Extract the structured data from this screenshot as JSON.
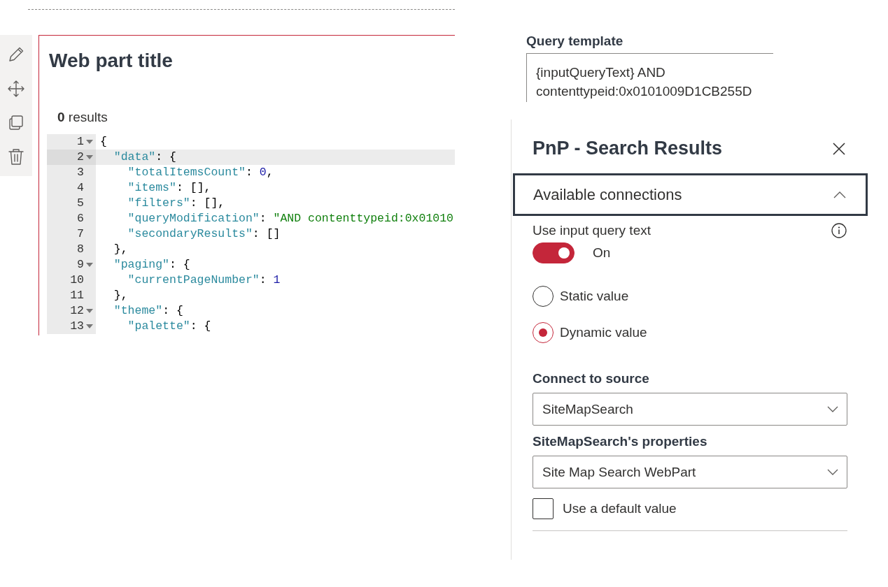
{
  "web_part": {
    "title": "Web part title",
    "results": "**0** results",
    "code_lines": [
      {
        "number": "1",
        "foldable": true,
        "selected": false,
        "tokens": [
          {
            "kind": "punct",
            "text": "{"
          }
        ]
      },
      {
        "number": "2",
        "foldable": true,
        "selected": true,
        "tokens": [
          {
            "kind": "key",
            "text": "  \"data\""
          },
          {
            "kind": "punct",
            "text": ": {"
          }
        ]
      },
      {
        "number": "3",
        "foldable": false,
        "selected": false,
        "tokens": [
          {
            "kind": "key",
            "text": "    \"totalItemsCount\""
          },
          {
            "kind": "punct",
            "text": ": "
          },
          {
            "kind": "number",
            "text": "0"
          },
          {
            "kind": "punct",
            "text": ","
          }
        ]
      },
      {
        "number": "4",
        "foldable": false,
        "selected": false,
        "tokens": [
          {
            "kind": "key",
            "text": "    \"items\""
          },
          {
            "kind": "punct",
            "text": ": [],"
          }
        ]
      },
      {
        "number": "5",
        "foldable": false,
        "selected": false,
        "tokens": [
          {
            "kind": "key",
            "text": "    \"filters\""
          },
          {
            "kind": "punct",
            "text": ": [],"
          }
        ]
      },
      {
        "number": "6",
        "foldable": false,
        "selected": false,
        "tokens": [
          {
            "kind": "key",
            "text": "    \"queryModification\""
          },
          {
            "kind": "punct",
            "text": ": "
          },
          {
            "kind": "string",
            "text": "\"AND contenttypeid:0x01010"
          }
        ]
      },
      {
        "number": "7",
        "foldable": false,
        "selected": false,
        "tokens": [
          {
            "kind": "key",
            "text": "    \"secondaryResults\""
          },
          {
            "kind": "punct",
            "text": ": []"
          }
        ]
      },
      {
        "number": "8",
        "foldable": false,
        "selected": false,
        "tokens": [
          {
            "kind": "punct",
            "text": "  },"
          }
        ]
      },
      {
        "number": "9",
        "foldable": true,
        "selected": false,
        "tokens": [
          {
            "kind": "key",
            "text": "  \"paging\""
          },
          {
            "kind": "punct",
            "text": ": {"
          }
        ]
      },
      {
        "number": "10",
        "foldable": false,
        "selected": false,
        "tokens": [
          {
            "kind": "key",
            "text": "    \"currentPageNumber\""
          },
          {
            "kind": "punct",
            "text": ": "
          },
          {
            "kind": "number",
            "text": "1"
          }
        ]
      },
      {
        "number": "11",
        "foldable": false,
        "selected": false,
        "tokens": [
          {
            "kind": "punct",
            "text": "  },"
          }
        ]
      },
      {
        "number": "12",
        "foldable": true,
        "selected": false,
        "tokens": [
          {
            "kind": "key",
            "text": "  \"theme\""
          },
          {
            "kind": "punct",
            "text": ": {"
          }
        ]
      },
      {
        "number": "13",
        "foldable": true,
        "selected": false,
        "tokens": [
          {
            "kind": "key",
            "text": "    \"palette\""
          },
          {
            "kind": "punct",
            "text": ": {"
          }
        ]
      }
    ]
  },
  "query_template": {
    "label": "Query template",
    "lines": [
      "{inputQueryText} AND",
      "contenttypeid:0x0101009D1CB255D"
    ]
  },
  "panel": {
    "title": "PnP - Search Results",
    "section": {
      "title": "Available connections",
      "expanded": true
    },
    "toggle": {
      "label": "Use input query text",
      "on": true,
      "state_text": "On"
    },
    "radios": [
      {
        "label": "Static value",
        "selected": false
      },
      {
        "label": "Dynamic value",
        "selected": true
      }
    ],
    "dropdowns": [
      {
        "label": "Connect to source",
        "value": "SiteMapSearch"
      },
      {
        "label": "SiteMapSearch's properties",
        "value": "Site Map Search WebPart"
      }
    ],
    "checkbox": {
      "label": "Use a default value",
      "checked": false
    }
  }
}
